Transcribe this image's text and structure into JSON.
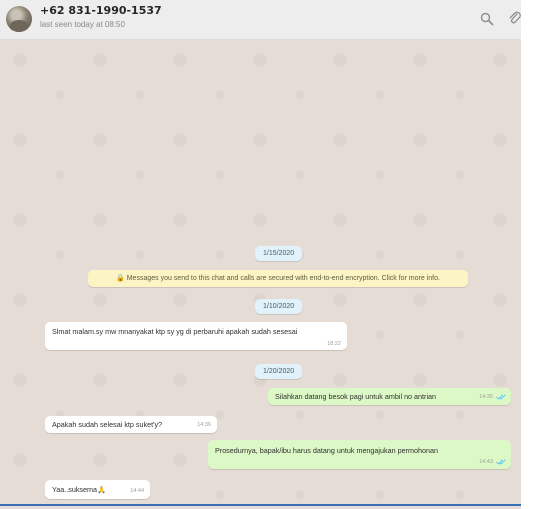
{
  "header": {
    "contact_name": "+62 831-1990-1537",
    "last_seen": "last seen today at 08:50",
    "icons": [
      "avatar",
      "search-icon",
      "paperclip-icon"
    ]
  },
  "chat": {
    "dates": {
      "d1": "1/15/2020",
      "d2": "1/10/2020",
      "d3": "1/20/2020"
    },
    "encryption_notice": "🔒 Messages you send to this chat and calls are secured with end-to-end encryption. Click for more info.",
    "messages": [
      {
        "direction": "in",
        "text": "Slmat malam.sy mw mnanyakat ktp sy yg di perbaruhi apakah sudah sesesai",
        "time": "18:22"
      },
      {
        "direction": "out",
        "text": "Silahkan datang besok pagi untuk ambil no antrian",
        "time": "14:35"
      },
      {
        "direction": "in",
        "text": "Apakah sudah selesai ktp suket'y?",
        "time": "14:36"
      },
      {
        "direction": "out",
        "text": "Prosedurnya, bapak/ibu harus datang untuk mengajukan permohonan",
        "time": "14:43"
      },
      {
        "direction": "in",
        "text": "Yaa..suksema🙏",
        "time": "14:44"
      }
    ]
  },
  "colors": {
    "chat_bg": "#e5ddd5",
    "incoming": "#ffffff",
    "outgoing": "#dcf8c6",
    "date_pill": "#e1f2fb",
    "notice": "#fdf4c5",
    "read_ticks": "#4fc3f7"
  }
}
